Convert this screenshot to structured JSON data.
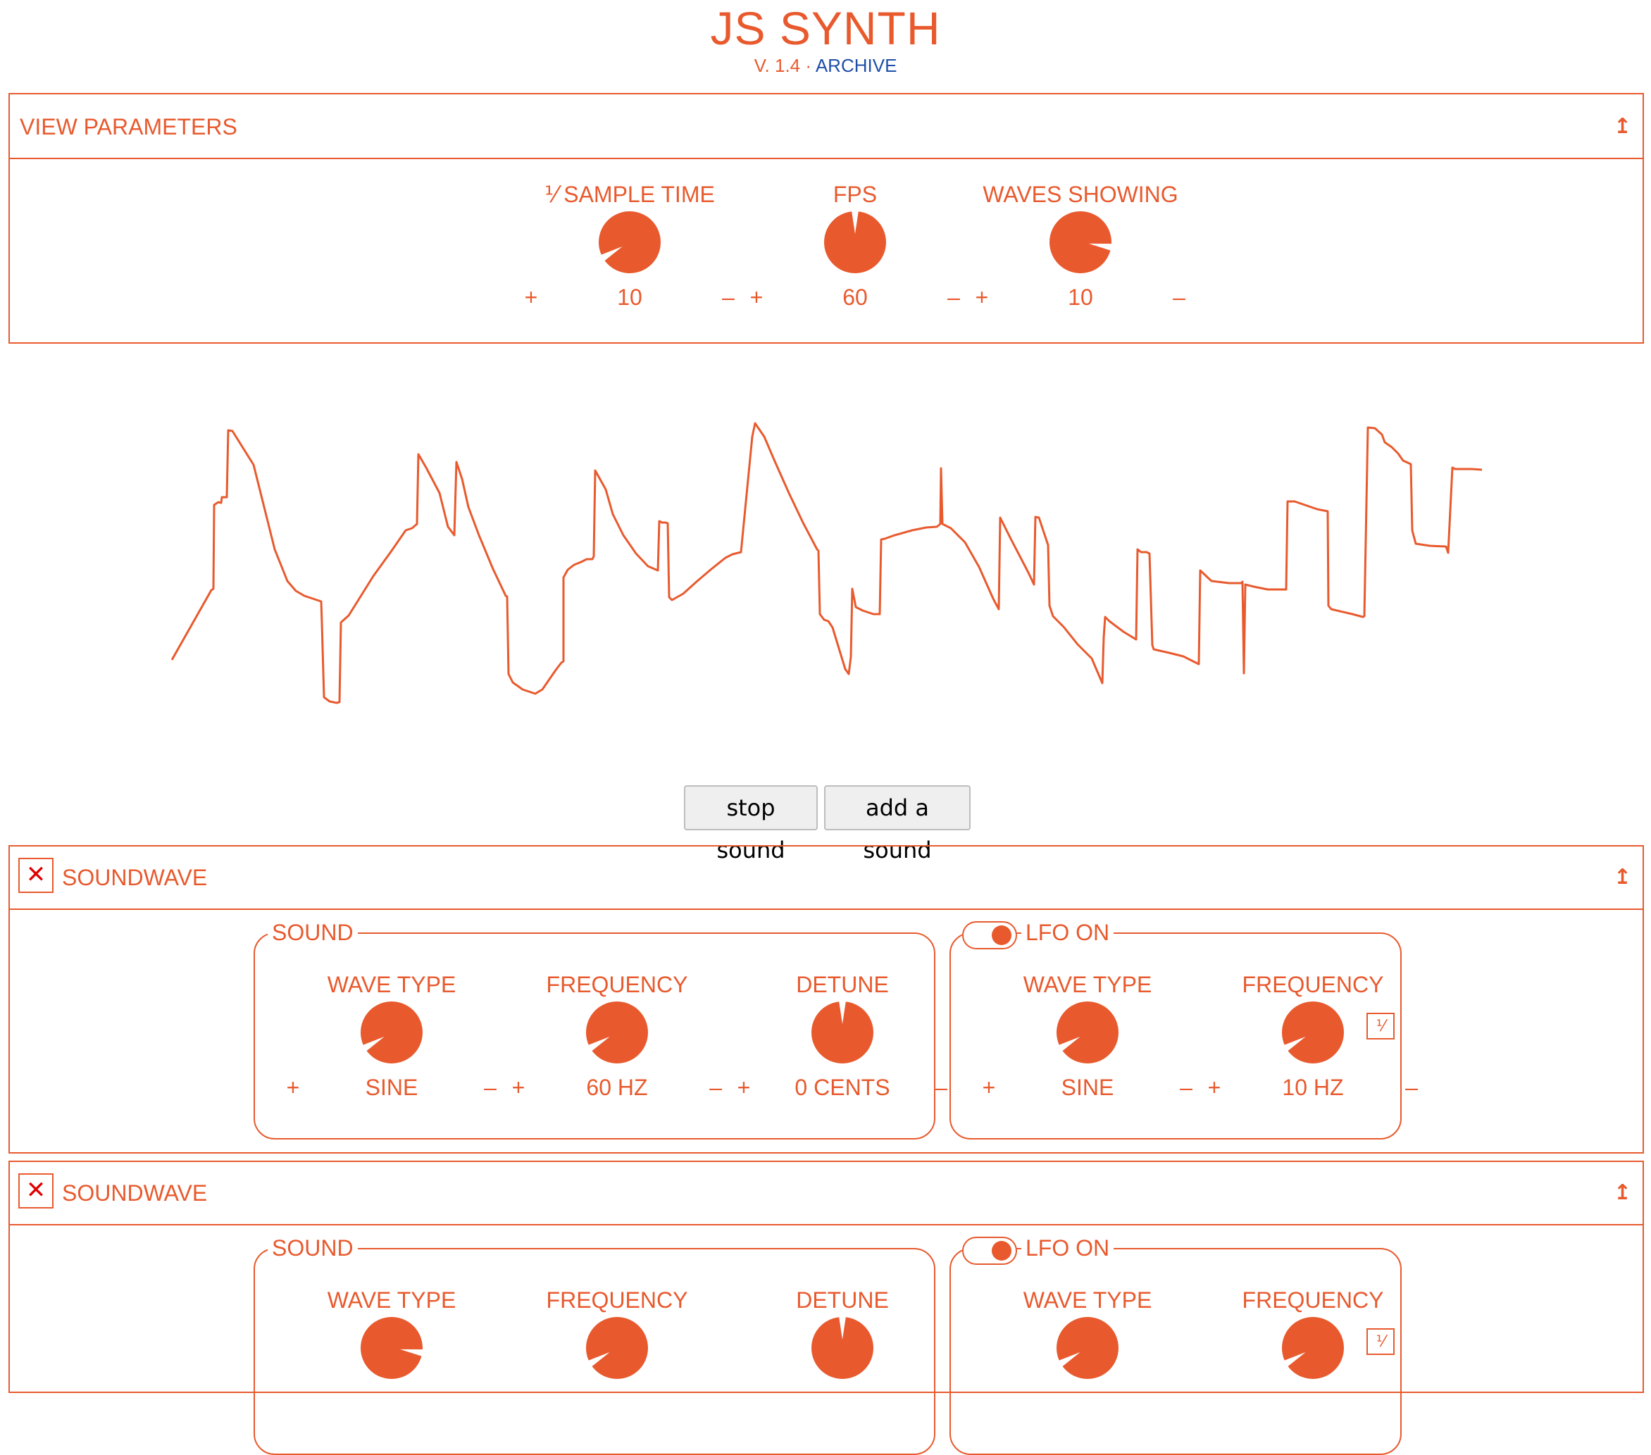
{
  "app": {
    "title": "JS SYNTH",
    "version": "V. 1.4",
    "separator": "·",
    "archive_link": "ARCHIVE",
    "accent_color": "#e85a2e",
    "link_color": "#1f4fa8"
  },
  "view_parameters": {
    "title": "VIEW PARAMETERS",
    "collapse_icon": "↥",
    "knobs": [
      {
        "label": "⅟ SAMPLE TIME",
        "value": "10",
        "plus": "+",
        "minus": "–",
        "level": 0.1
      },
      {
        "label": "FPS",
        "value": "60",
        "plus": "+",
        "minus": "–",
        "level": 0.5
      },
      {
        "label": "WAVES SHOWING",
        "value": "10",
        "plus": "+",
        "minus": "–",
        "level": 0.83
      }
    ]
  },
  "buttons": {
    "stop": "stop sound",
    "add": "add a sound"
  },
  "soundwaves": [
    {
      "title": "SOUNDWAVE",
      "close_icon": "✕",
      "collapse_icon": "↥",
      "sound": {
        "legend": "SOUND",
        "knobs": [
          {
            "label": "WAVE TYPE",
            "value": "SINE",
            "plus": "+",
            "minus": "–",
            "level": 0.1
          },
          {
            "label": "FREQUENCY",
            "value": "60 HZ",
            "plus": "+",
            "minus": "–",
            "level": 0.1
          },
          {
            "label": "DETUNE",
            "value": "0 CENTS",
            "plus": "+",
            "minus": "–",
            "level": 0.5
          }
        ]
      },
      "lfo": {
        "legend": "LFO ON",
        "toggle_on": true,
        "reciprocal_icon": "⅟",
        "knobs": [
          {
            "label": "WAVE TYPE",
            "value": "SINE",
            "plus": "+",
            "minus": "–",
            "level": 0.1
          },
          {
            "label": "FREQUENCY",
            "value": "10 HZ",
            "plus": "+",
            "minus": "–",
            "level": 0.1
          }
        ]
      }
    },
    {
      "title": "SOUNDWAVE",
      "close_icon": "✕",
      "collapse_icon": "↥",
      "sound": {
        "legend": "SOUND",
        "knobs": [
          {
            "label": "WAVE TYPE",
            "level": 0.83
          },
          {
            "label": "FREQUENCY",
            "level": 0.1
          },
          {
            "label": "DETUNE",
            "level": 0.5
          }
        ]
      },
      "lfo": {
        "legend": "LFO ON",
        "toggle_on": true,
        "reciprocal_icon": "⅟",
        "knobs": [
          {
            "label": "WAVE TYPE",
            "level": 0.1
          },
          {
            "label": "FREQUENCY",
            "level": 0.1
          }
        ]
      }
    }
  ]
}
